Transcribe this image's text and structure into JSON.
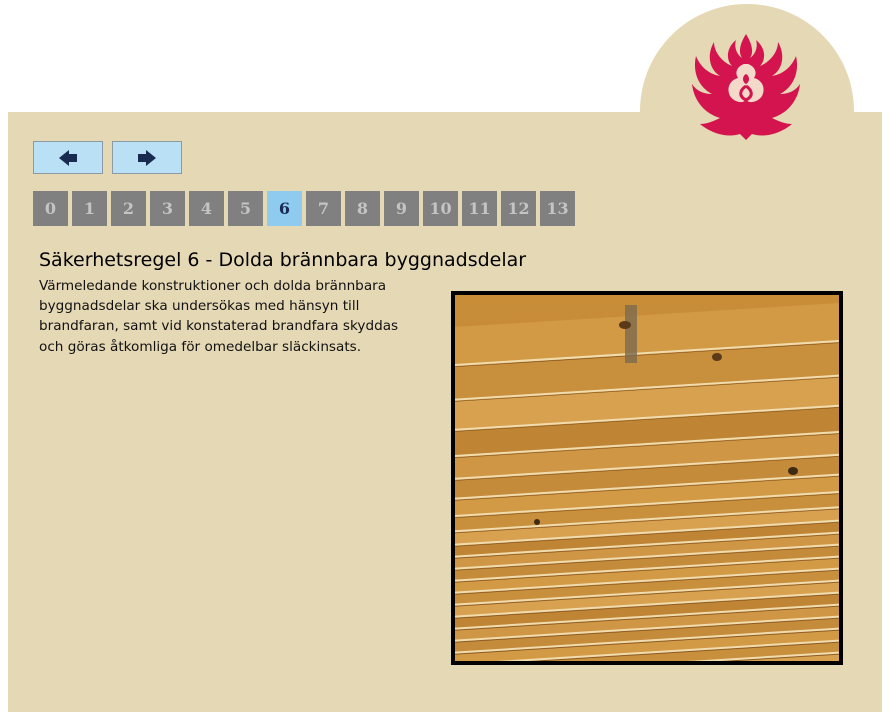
{
  "colors": {
    "panel_bg": "#e5d8b5",
    "logo_red": "#d4144e",
    "nav_button_bg": "#b9e0f5",
    "nav_arrow": "#1a2b52",
    "page_bg": "#808080",
    "page_active_bg": "#8fcbef"
  },
  "logo": {
    "icon": "phoenix-flame-logo"
  },
  "nav": {
    "prev_icon": "arrow-left-icon",
    "next_icon": "arrow-right-icon"
  },
  "pagination": {
    "pages": [
      "0",
      "1",
      "2",
      "3",
      "4",
      "5",
      "6",
      "7",
      "8",
      "9",
      "10",
      "11",
      "12",
      "13"
    ],
    "active": "6"
  },
  "content": {
    "title": "Säkerhetsregel 6 - Dolda brännbara byggnadsdelar",
    "body": "Värmeledande konstruktioner och dolda brännbara byggnadsdelar ska undersökas med hänsyn till brandfaran, samt vid konstaterad brandfara skyddas och göras åtkomliga för omedelbar släckinsats."
  },
  "image": {
    "subject": "wooden-plank-ceiling-photo"
  }
}
